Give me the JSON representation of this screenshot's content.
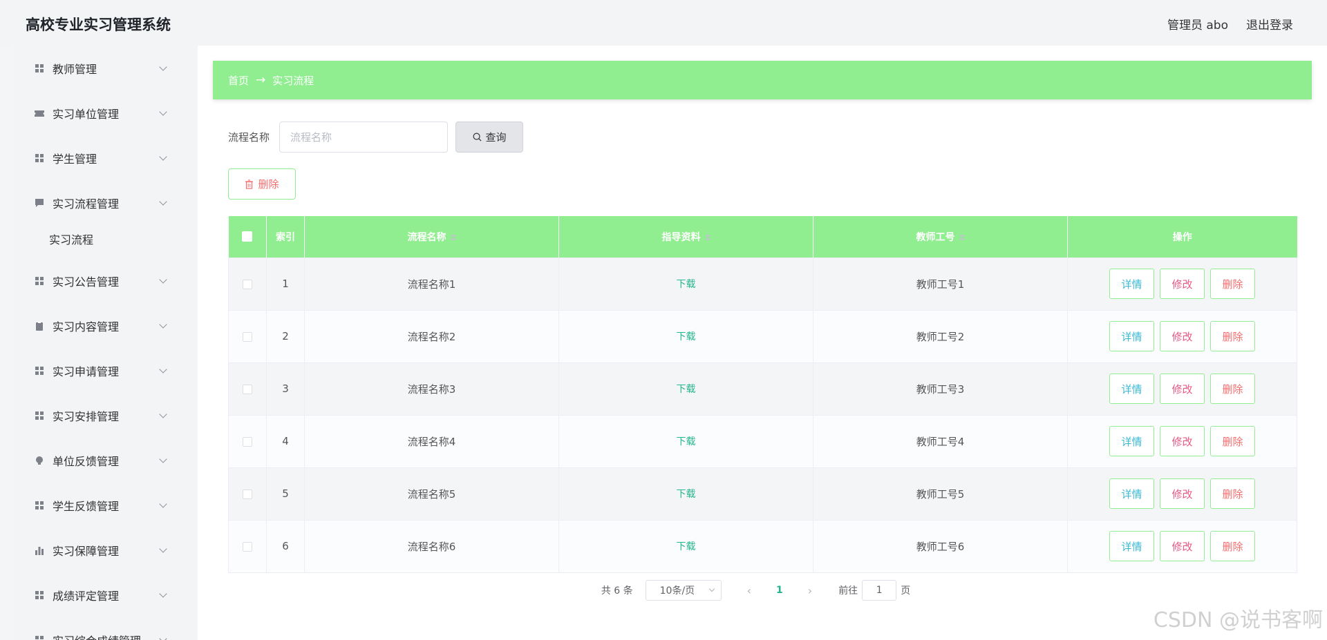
{
  "header": {
    "app_title": "高校专业实习管理系统",
    "user_label": "管理员 abo",
    "logout_label": "退出登录"
  },
  "sidebar": {
    "items": [
      {
        "label": "教师管理",
        "icon": "grid-icon"
      },
      {
        "label": "实习单位管理",
        "icon": "ticket-icon"
      },
      {
        "label": "学生管理",
        "icon": "grid-icon"
      },
      {
        "label": "实习流程管理",
        "icon": "chat-icon",
        "expanded": true
      },
      {
        "label": "实习公告管理",
        "icon": "grid-icon"
      },
      {
        "label": "实习内容管理",
        "icon": "clipboard-icon"
      },
      {
        "label": "实习申请管理",
        "icon": "grid-icon"
      },
      {
        "label": "实习安排管理",
        "icon": "grid-icon"
      },
      {
        "label": "单位反馈管理",
        "icon": "bulb-icon"
      },
      {
        "label": "学生反馈管理",
        "icon": "grid-icon"
      },
      {
        "label": "实习保障管理",
        "icon": "bar-chart-icon"
      },
      {
        "label": "成绩评定管理",
        "icon": "grid-icon"
      },
      {
        "label": "实习综合成绩管理",
        "icon": "grid-icon"
      }
    ],
    "submenu": {
      "label": "实习流程"
    }
  },
  "breadcrumb": {
    "home": "首页",
    "arrow": "→",
    "current": "实习流程"
  },
  "search": {
    "label": "流程名称",
    "placeholder": "流程名称",
    "value": "",
    "button_label": "查询"
  },
  "toolbar": {
    "delete_label": "删除"
  },
  "table": {
    "columns": [
      "索引",
      "流程名称",
      "指导资料",
      "教师工号",
      "操作"
    ],
    "rows": [
      {
        "index": "1",
        "name": "流程名称1",
        "material": "下载",
        "teacher_id": "教师工号1"
      },
      {
        "index": "2",
        "name": "流程名称2",
        "material": "下载",
        "teacher_id": "教师工号2"
      },
      {
        "index": "3",
        "name": "流程名称3",
        "material": "下载",
        "teacher_id": "教师工号3"
      },
      {
        "index": "4",
        "name": "流程名称4",
        "material": "下载",
        "teacher_id": "教师工号4"
      },
      {
        "index": "5",
        "name": "流程名称5",
        "material": "下载",
        "teacher_id": "教师工号5"
      },
      {
        "index": "6",
        "name": "流程名称6",
        "material": "下载",
        "teacher_id": "教师工号6"
      }
    ],
    "actions": {
      "detail": "详情",
      "edit": "修改",
      "delete": "删除"
    }
  },
  "pagination": {
    "total": "共 6 条",
    "page_size": "10条/页",
    "prev": "‹",
    "current_page": "1",
    "next": "›",
    "goto_label": "前往",
    "goto_value": "1",
    "goto_suffix": "页"
  },
  "watermark": "CSDN @说书客啊",
  "colors": {
    "accent": "#90ee90",
    "link": "#23b58c",
    "danger": "#f56c6c"
  }
}
